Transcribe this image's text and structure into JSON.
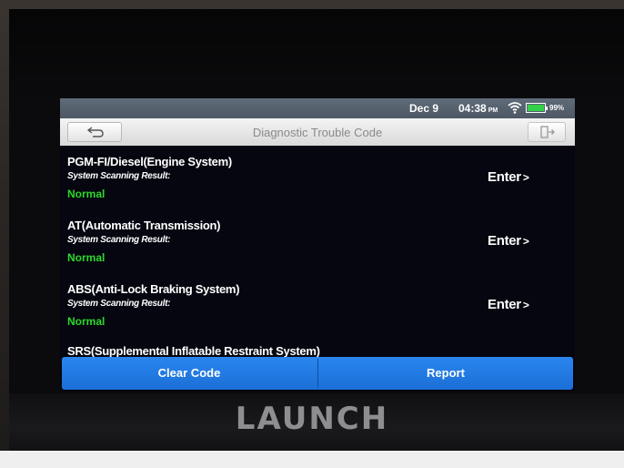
{
  "status_bar": {
    "date": "Dec 9",
    "time": "04:38",
    "ampm": "PM",
    "battery_percent": "99%",
    "battery_level": 0.99,
    "icons": [
      "wifi-icon",
      "battery-icon"
    ]
  },
  "header": {
    "title": "Diagnostic Trouble Code",
    "back_icon": "back-arrow-icon",
    "exit_icon": "exit-door-icon"
  },
  "systems": [
    {
      "name": "PGM-FI/Diesel(Engine System)",
      "caption": "System Scanning Result:",
      "result": "Normal",
      "action": "Enter"
    },
    {
      "name": "AT(Automatic Transmission)",
      "caption": "System Scanning Result:",
      "result": "Normal",
      "action": "Enter"
    },
    {
      "name": "ABS(Anti-Lock Braking System)",
      "caption": "System Scanning Result:",
      "result": "Normal",
      "action": "Enter"
    },
    {
      "name": "SRS(Supplemental Inflatable Restraint System)"
    }
  ],
  "actions": {
    "clear_code": "Clear Code",
    "report": "Report"
  },
  "device": {
    "brand": "LAUNCH"
  },
  "colors": {
    "accent_blue": "#2a86ef",
    "normal_green": "#2bd82b",
    "battery_green": "#34d04a"
  }
}
